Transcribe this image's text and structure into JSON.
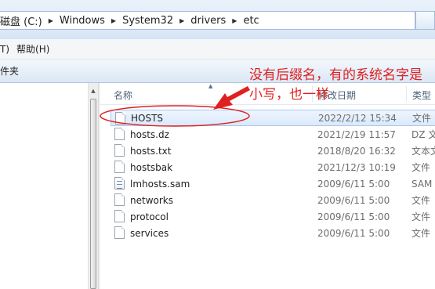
{
  "address_bar": {
    "crumbs": [
      "磁盘 (C:)",
      "Windows",
      "System32",
      "drivers",
      "etc"
    ]
  },
  "menu": {
    "items": [
      "T)",
      "帮助(H)"
    ]
  },
  "command_bar": {
    "item": "件夹"
  },
  "columns": {
    "name": "名称",
    "date": "修改日期",
    "type": "类型"
  },
  "files": [
    {
      "name": "HOSTS",
      "date": "2022/2/12 15:34",
      "type": "文件",
      "icon": "file-icon",
      "selected": true
    },
    {
      "name": "hosts.dz",
      "date": "2021/2/19 11:57",
      "type": "DZ 文",
      "icon": "file-icon"
    },
    {
      "name": "hosts.txt",
      "date": "2018/8/20 16:32",
      "type": "文本文",
      "icon": "file-icon"
    },
    {
      "name": "hostsbak",
      "date": "2021/12/3 10:19",
      "type": "文件",
      "icon": "file-icon"
    },
    {
      "name": "lmhosts.sam",
      "date": "2009/6/11 5:00",
      "type": "SAM",
      "icon": "sam-file-icon"
    },
    {
      "name": "networks",
      "date": "2009/6/11 5:00",
      "type": "文件",
      "icon": "file-icon"
    },
    {
      "name": "protocol",
      "date": "2009/6/11 5:00",
      "type": "文件",
      "icon": "file-icon"
    },
    {
      "name": "services",
      "date": "2009/6/11 5:00",
      "type": "文件",
      "icon": "file-icon"
    }
  ],
  "annotation": {
    "text": "没有后缀名，有的系统名字是小写，也一样",
    "color": "#e02020"
  },
  "colors": {
    "selection": "#dbe9fb",
    "annotation": "#e02020",
    "header_text": "#4c607a"
  }
}
